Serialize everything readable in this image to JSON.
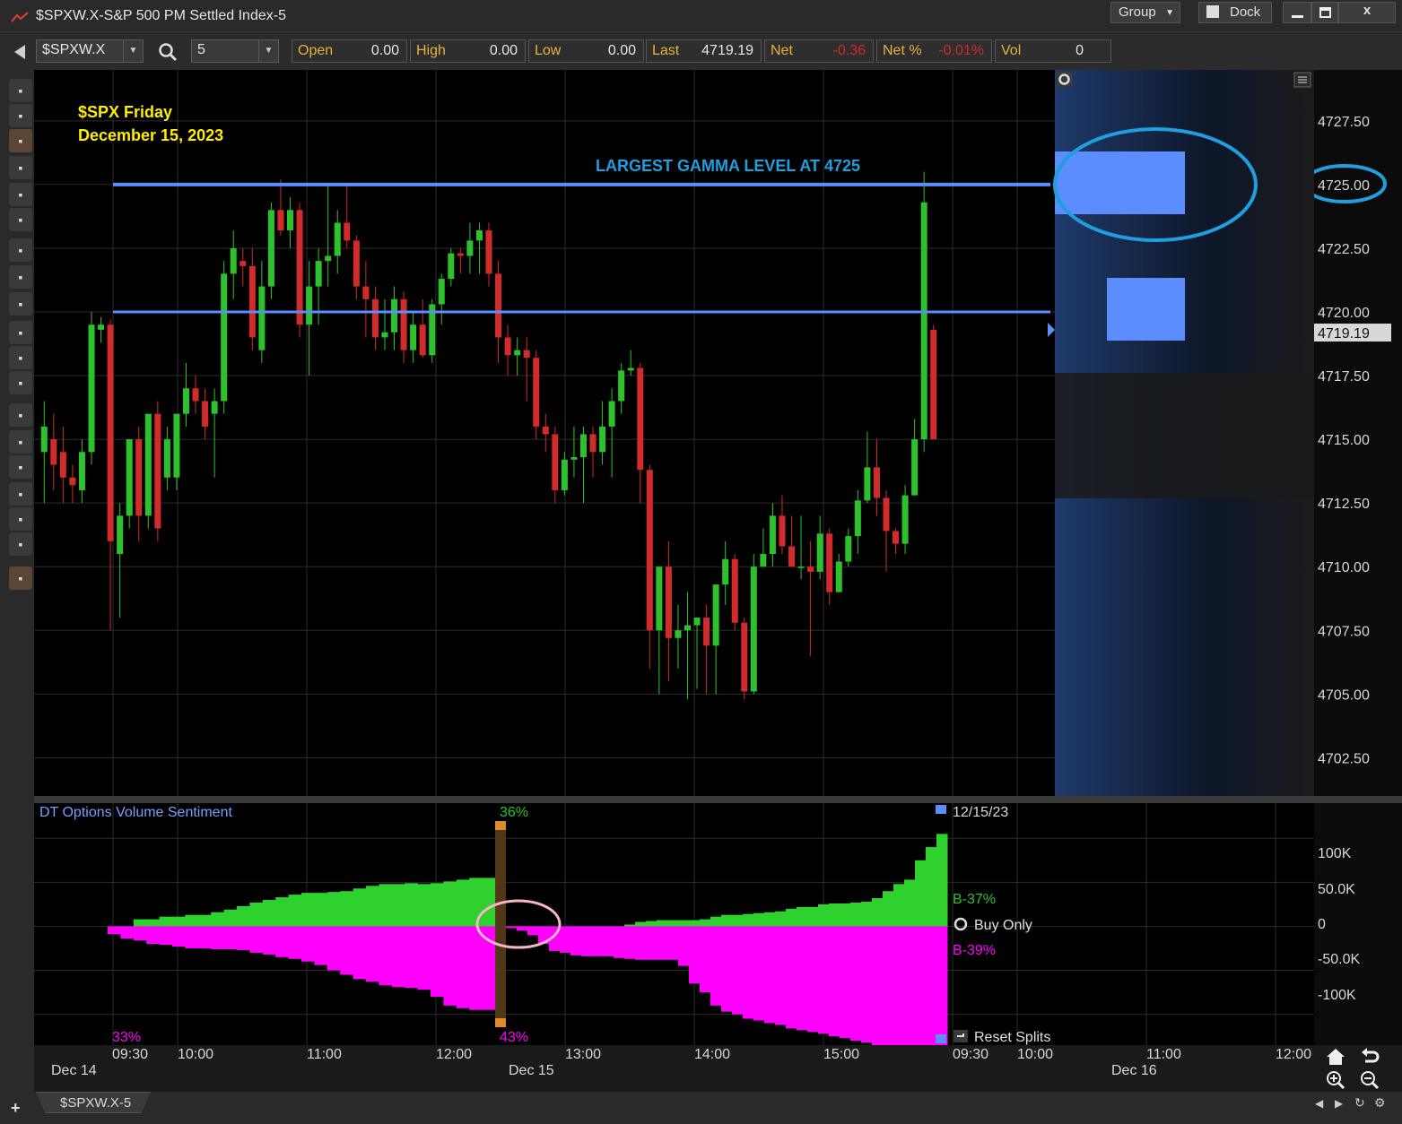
{
  "window": {
    "title": "$SPXW.X-S&P 500 PM Settled Index-5",
    "group_label": "Group",
    "dock_label": "Dock",
    "min_icon": "minimize-icon",
    "max_icon": "maximize-icon",
    "close_label": "x"
  },
  "toolbar": {
    "symbol": "$SPXW.X",
    "interval": "5",
    "open_label": "Open",
    "open_value": "0.00",
    "high_label": "High",
    "high_value": "0.00",
    "low_label": "Low",
    "low_value": "0.00",
    "last_label": "Last",
    "last_value": "4719.19",
    "net_label": "Net",
    "net_value": "-0.36",
    "netpct_label": "Net %",
    "netpct_value": "-0.01%",
    "vol_label": "Vol",
    "vol_value": "0"
  },
  "tools": [
    "cursor-icon",
    "pan-icon",
    "candlestick-icon",
    "bar-icon",
    "line-icon",
    "area-icon",
    "crosshair-icon",
    "trendline-icon",
    "grid-icon",
    "table-icon",
    "layout-icon",
    "horizontal-line-icon",
    "fib-icon",
    "note-icon",
    "home-icon",
    "undo-icon",
    "zoom-in-icon",
    "zoom-out-icon",
    "pointer-icon"
  ],
  "annotations": {
    "title_line1": "$SPX Friday",
    "title_line2": "December 15, 2023",
    "gamma_label": "LARGEST GAMMA LEVEL AT 4725"
  },
  "colors": {
    "up": "#2ec12e",
    "down": "#d12b2b",
    "gamma_line": "#5b8dff",
    "annotation_yellow": "#ffee00",
    "annotation_cyan": "#1f9ee0",
    "buy": "#2ed12e",
    "sell": "#ff00ff"
  },
  "price_axis": {
    "ticks": [
      "4727.50",
      "4725.00",
      "4722.50",
      "4720.00",
      "4719.19",
      "4717.50",
      "4715.00",
      "4712.50",
      "4710.00",
      "4707.50",
      "4705.00",
      "4702.50"
    ],
    "current": "4719.19"
  },
  "indicator": {
    "title": "DT Options Volume Sentiment",
    "top_pct": "36%",
    "bottom_left_pct": "33%",
    "bottom_mid_pct": "43%",
    "date": "12/15/23",
    "buy_pct": "B-37%",
    "buy_only": "Buy Only",
    "sell_pct": "B-39%",
    "reset": "Reset Splits",
    "axis": [
      "100K",
      "50.0K",
      "0",
      "-50.0K",
      "-100K"
    ]
  },
  "time_axis": {
    "labels_top": [
      "09:30",
      "10:00",
      "11:00",
      "12:00",
      "13:00",
      "14:00",
      "15:00",
      "09:30",
      "10:00",
      "11:00",
      "12:00"
    ],
    "labels_bottom": [
      "Dec 14",
      "Dec 15",
      "Dec 16"
    ]
  },
  "tab": {
    "label": "$SPXW.X-5"
  },
  "chart_data": {
    "type": "candlestick",
    "ylim": [
      4701,
      4729.5
    ],
    "horizontal_lines": [
      4725.0,
      4720.0
    ],
    "candles": [
      {
        "o": 4714.5,
        "h": 4716.5,
        "l": 4712.5,
        "c": 4715.5
      },
      {
        "o": 4715,
        "h": 4716,
        "l": 4713,
        "c": 4714
      },
      {
        "o": 4714.5,
        "h": 4715.5,
        "l": 4712.5,
        "c": 4713.5
      },
      {
        "o": 4713.5,
        "h": 4714,
        "l": 4712.5,
        "c": 4713.2
      },
      {
        "o": 4713,
        "h": 4715,
        "l": 4712.5,
        "c": 4714.5
      },
      {
        "o": 4714.5,
        "h": 4720,
        "l": 4714,
        "c": 4719.5
      },
      {
        "o": 4719.3,
        "h": 4719.8,
        "l": 4718.8,
        "c": 4719.5
      },
      {
        "o": 4719.5,
        "h": 4719.7,
        "l": 4707.5,
        "c": 4711
      },
      {
        "o": 4710.5,
        "h": 4712.5,
        "l": 4708,
        "c": 4712
      },
      {
        "o": 4712,
        "h": 4715,
        "l": 4711.5,
        "c": 4715
      },
      {
        "o": 4715,
        "h": 4715.5,
        "l": 4711,
        "c": 4712
      },
      {
        "o": 4712,
        "h": 4716,
        "l": 4711.5,
        "c": 4716
      },
      {
        "o": 4716,
        "h": 4716.5,
        "l": 4711,
        "c": 4711.5
      },
      {
        "o": 4713.5,
        "h": 4715.5,
        "l": 4713,
        "c": 4715
      },
      {
        "o": 4713.5,
        "h": 4716,
        "l": 4713,
        "c": 4716
      },
      {
        "o": 4716,
        "h": 4718,
        "l": 4715.5,
        "c": 4717
      },
      {
        "o": 4717,
        "h": 4717.5,
        "l": 4716,
        "c": 4716.5
      },
      {
        "o": 4716.5,
        "h": 4717,
        "l": 4715,
        "c": 4715.5
      },
      {
        "o": 4716,
        "h": 4717,
        "l": 4713.5,
        "c": 4716.5
      },
      {
        "o": 4716.5,
        "h": 4722,
        "l": 4716,
        "c": 4721.5
      },
      {
        "o": 4721.5,
        "h": 4723.2,
        "l": 4720.5,
        "c": 4722.5
      },
      {
        "o": 4722,
        "h": 4722.5,
        "l": 4721,
        "c": 4721.8
      },
      {
        "o": 4721.8,
        "h": 4722.5,
        "l": 4718.5,
        "c": 4719
      },
      {
        "o": 4718.5,
        "h": 4722,
        "l": 4718,
        "c": 4721
      },
      {
        "o": 4721,
        "h": 4724.3,
        "l": 4720.5,
        "c": 4724
      },
      {
        "o": 4724,
        "h": 4725.2,
        "l": 4723,
        "c": 4723.2
      },
      {
        "o": 4723.2,
        "h": 4724.5,
        "l": 4722.5,
        "c": 4724
      },
      {
        "o": 4724,
        "h": 4724.3,
        "l": 4719,
        "c": 4719.5
      },
      {
        "o": 4719.5,
        "h": 4722,
        "l": 4717.5,
        "c": 4721
      },
      {
        "o": 4721,
        "h": 4722.5,
        "l": 4719.5,
        "c": 4722
      },
      {
        "o": 4722,
        "h": 4725,
        "l": 4721,
        "c": 4722.2
      },
      {
        "o": 4722.2,
        "h": 4724,
        "l": 4721.5,
        "c": 4723.5
      },
      {
        "o": 4723.5,
        "h": 4725,
        "l": 4722.5,
        "c": 4722.8
      },
      {
        "o": 4722.8,
        "h": 4723,
        "l": 4720.5,
        "c": 4721
      },
      {
        "o": 4721,
        "h": 4722,
        "l": 4719,
        "c": 4720.5
      },
      {
        "o": 4720.5,
        "h": 4721,
        "l": 4718.5,
        "c": 4719
      },
      {
        "o": 4719,
        "h": 4720.5,
        "l": 4718.5,
        "c": 4719.2
      },
      {
        "o": 4719.2,
        "h": 4721,
        "l": 4718.5,
        "c": 4720.5
      },
      {
        "o": 4720.5,
        "h": 4720.8,
        "l": 4718,
        "c": 4718.5
      },
      {
        "o": 4718.5,
        "h": 4720,
        "l": 4718,
        "c": 4719.5
      },
      {
        "o": 4719.5,
        "h": 4720.5,
        "l": 4718.2,
        "c": 4718.3
      },
      {
        "o": 4718.3,
        "h": 4720.5,
        "l": 4718,
        "c": 4720.3
      },
      {
        "o": 4720.3,
        "h": 4721.5,
        "l": 4719.5,
        "c": 4721.3
      },
      {
        "o": 4721.3,
        "h": 4722.5,
        "l": 4721,
        "c": 4722.3
      },
      {
        "o": 4722.3,
        "h": 4722.5,
        "l": 4721.5,
        "c": 4722.2
      },
      {
        "o": 4722.2,
        "h": 4723.5,
        "l": 4721.5,
        "c": 4722.8
      },
      {
        "o": 4722.8,
        "h": 4723.5,
        "l": 4721.5,
        "c": 4723.2
      },
      {
        "o": 4723.2,
        "h": 4723.5,
        "l": 4721,
        "c": 4721.5
      },
      {
        "o": 4721.5,
        "h": 4722,
        "l": 4718,
        "c": 4719
      },
      {
        "o": 4719,
        "h": 4719.5,
        "l": 4717.5,
        "c": 4718.3
      },
      {
        "o": 4718.3,
        "h": 4719,
        "l": 4717.5,
        "c": 4718.5
      },
      {
        "o": 4718.5,
        "h": 4719,
        "l": 4716.5,
        "c": 4718.2
      },
      {
        "o": 4718.2,
        "h": 4718.5,
        "l": 4715,
        "c": 4715.5
      },
      {
        "o": 4715.5,
        "h": 4716,
        "l": 4714.5,
        "c": 4715.2
      },
      {
        "o": 4715.2,
        "h": 4715.5,
        "l": 4712.5,
        "c": 4713
      },
      {
        "o": 4713,
        "h": 4714.5,
        "l": 4712.8,
        "c": 4714.2
      },
      {
        "o": 4714.2,
        "h": 4715.5,
        "l": 4713.5,
        "c": 4714.3
      },
      {
        "o": 4714.3,
        "h": 4715.5,
        "l": 4712.5,
        "c": 4715.2
      },
      {
        "o": 4715.2,
        "h": 4715.5,
        "l": 4713.5,
        "c": 4714.5
      },
      {
        "o": 4714.5,
        "h": 4716.5,
        "l": 4714,
        "c": 4715.5
      },
      {
        "o": 4715.5,
        "h": 4717,
        "l": 4713.5,
        "c": 4716.5
      },
      {
        "o": 4716.5,
        "h": 4718,
        "l": 4716,
        "c": 4717.7
      },
      {
        "o": 4717.7,
        "h": 4718.5,
        "l": 4717.5,
        "c": 4717.8
      },
      {
        "o": 4717.8,
        "h": 4718,
        "l": 4712.5,
        "c": 4713.8
      },
      {
        "o": 4713.8,
        "h": 4714,
        "l": 4706,
        "c": 4707.5
      },
      {
        "o": 4707.5,
        "h": 4710,
        "l": 4705,
        "c": 4710
      },
      {
        "o": 4710,
        "h": 4711,
        "l": 4705.5,
        "c": 4707.2
      },
      {
        "o": 4707.2,
        "h": 4708.5,
        "l": 4706,
        "c": 4707.5
      },
      {
        "o": 4707.5,
        "h": 4709,
        "l": 4704.8,
        "c": 4707.7
      },
      {
        "o": 4707.7,
        "h": 4708,
        "l": 4705.2,
        "c": 4708
      },
      {
        "o": 4708,
        "h": 4708.5,
        "l": 4705,
        "c": 4706.9
      },
      {
        "o": 4706.9,
        "h": 4709,
        "l": 4705,
        "c": 4709.3
      },
      {
        "o": 4709.3,
        "h": 4711,
        "l": 4708.5,
        "c": 4710.3
      },
      {
        "o": 4710.3,
        "h": 4710.5,
        "l": 4707.5,
        "c": 4707.8
      },
      {
        "o": 4707.8,
        "h": 4708,
        "l": 4704.8,
        "c": 4705.1
      },
      {
        "o": 4705.1,
        "h": 4710.5,
        "l": 4705,
        "c": 4710.0
      },
      {
        "o": 4710.0,
        "h": 4711.5,
        "l": 4710,
        "c": 4710.5
      },
      {
        "o": 4710.5,
        "h": 4712.5,
        "l": 4710,
        "c": 4712
      },
      {
        "o": 4712,
        "h": 4712.8,
        "l": 4710.5,
        "c": 4710.8
      },
      {
        "o": 4710.8,
        "h": 4712,
        "l": 4710,
        "c": 4710.0
      },
      {
        "o": 4710.0,
        "h": 4712,
        "l": 4709.5,
        "c": 4710.0
      },
      {
        "o": 4710.0,
        "h": 4711,
        "l": 4706.5,
        "c": 4709.8
      },
      {
        "o": 4709.8,
        "h": 4712,
        "l": 4709.5,
        "c": 4711.3
      },
      {
        "o": 4711.3,
        "h": 4711.5,
        "l": 4708.5,
        "c": 4709
      },
      {
        "o": 4709,
        "h": 4710.5,
        "l": 4709,
        "c": 4710.2
      },
      {
        "o": 4710.2,
        "h": 4711.5,
        "l": 4710,
        "c": 4711.2
      },
      {
        "o": 4711.2,
        "h": 4713,
        "l": 4710.5,
        "c": 4712.6
      },
      {
        "o": 4712.6,
        "h": 4715.3,
        "l": 4712.5,
        "c": 4713.9
      },
      {
        "o": 4713.9,
        "h": 4715,
        "l": 4712,
        "c": 4712.7
      },
      {
        "o": 4712.7,
        "h": 4713,
        "l": 4709.8,
        "c": 4711.4
      },
      {
        "o": 4711.4,
        "h": 4711.5,
        "l": 4710.5,
        "c": 4710.9
      },
      {
        "o": 4710.9,
        "h": 4713.2,
        "l": 4710.5,
        "c": 4712.8
      },
      {
        "o": 4712.8,
        "h": 4715.8,
        "l": 4714.5,
        "c": 4715.0
      },
      {
        "o": 4715.0,
        "h": 4725.5,
        "l": 4714.5,
        "c": 4724.3
      },
      {
        "o": 4719.3,
        "h": 4719.5,
        "l": 4715,
        "c": 4715
      }
    ],
    "sentiment": {
      "type": "area",
      "ylim": [
        -135000,
        140000
      ],
      "buy": [
        0,
        0,
        8000,
        8000,
        11000,
        11000,
        13000,
        13000,
        16000,
        19000,
        23000,
        27000,
        30000,
        33000,
        36000,
        38000,
        38000,
        39000,
        40000,
        43000,
        46000,
        48000,
        48000,
        49000,
        48000,
        49000,
        51000,
        53000,
        55000,
        55000,
        0,
        0,
        0,
        0,
        0,
        0,
        0,
        0,
        0,
        0,
        0,
        0,
        2000,
        5000,
        6000,
        7000,
        7000,
        7000,
        7000,
        8000,
        11000,
        13000,
        13000,
        14000,
        15000,
        16000,
        17000,
        20000,
        22000,
        22000,
        25000,
        26000,
        26000,
        27000,
        28000,
        32000,
        40000,
        48000,
        53000,
        75000,
        90000,
        105000
      ],
      "sell": [
        -9000,
        -14000,
        -16000,
        -20000,
        -21000,
        -23000,
        -25000,
        -25000,
        -26000,
        -26000,
        -27000,
        -30000,
        -32000,
        -35000,
        -37000,
        -40000,
        -44000,
        -50000,
        -55000,
        -60000,
        -63000,
        -67000,
        -69000,
        -70000,
        -72000,
        -80000,
        -90000,
        -93000,
        -95000,
        -95000,
        0,
        -2000,
        -5000,
        -10000,
        -20000,
        -28000,
        -30000,
        -33000,
        -34000,
        -34000,
        -34000,
        -36000,
        -37000,
        -38000,
        -38000,
        -38000,
        -38000,
        -45000,
        -65000,
        -75000,
        -90000,
        -97000,
        -100000,
        -105000,
        -107000,
        -110000,
        -112000,
        -116000,
        -118000,
        -120000,
        -122000,
        -125000,
        -127000,
        -130000,
        -132000,
        -140000,
        -148000,
        -150000,
        -150000,
        -152000,
        -152000,
        -152000
      ]
    }
  }
}
